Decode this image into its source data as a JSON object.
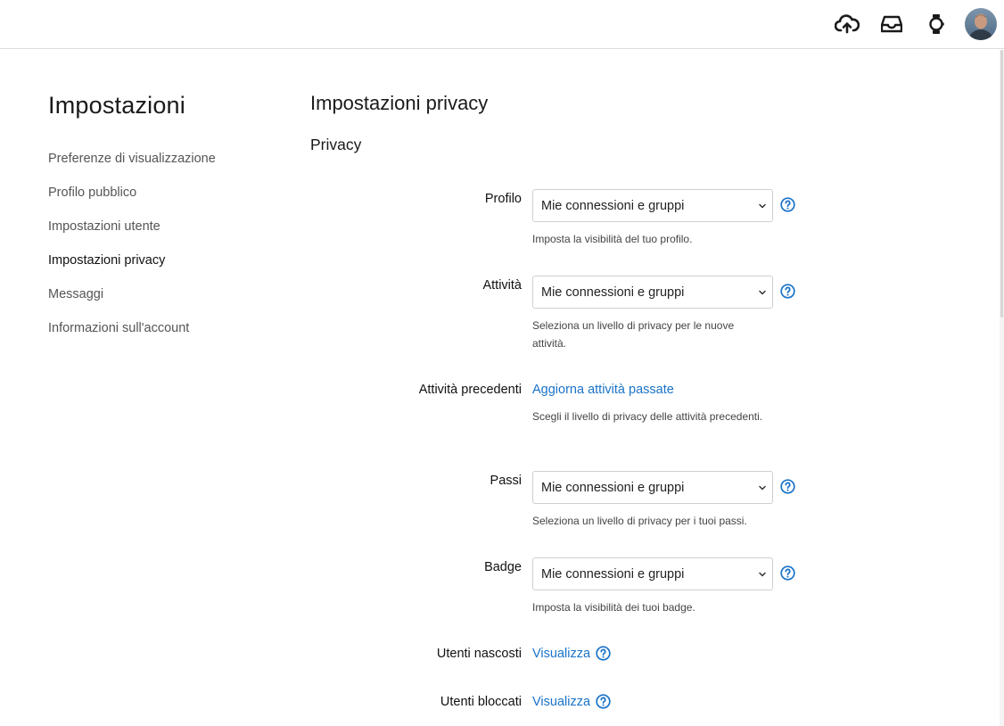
{
  "header": {
    "icons": {
      "upload": "cloud-upload-icon",
      "inbox": "inbox-icon",
      "device": "watch-icon",
      "avatar": "user-avatar"
    }
  },
  "sidebar": {
    "title": "Impostazioni",
    "items": [
      {
        "label": "Preferenze di visualizzazione",
        "active": false
      },
      {
        "label": "Profilo pubblico",
        "active": false
      },
      {
        "label": "Impostazioni utente",
        "active": false
      },
      {
        "label": "Impostazioni privacy",
        "active": true
      },
      {
        "label": "Messaggi",
        "active": false
      },
      {
        "label": "Informazioni sull'account",
        "active": false
      }
    ]
  },
  "main": {
    "page_title": "Impostazioni privacy",
    "section_title": "Privacy",
    "fields": {
      "profilo": {
        "label": "Profilo",
        "value": "Mie connessioni e gruppi",
        "hint": "Imposta la visibilità del tuo profilo."
      },
      "attivita": {
        "label": "Attività",
        "value": "Mie connessioni e gruppi",
        "hint": "Seleziona un livello di privacy per le nuove attività."
      },
      "attivita_precedenti": {
        "label": "Attività precedenti",
        "link": "Aggiorna attività passate",
        "hint": "Scegli il livello di privacy delle attività precedenti."
      },
      "passi": {
        "label": "Passi",
        "value": "Mie connessioni e gruppi",
        "hint": "Seleziona un livello di privacy per i tuoi passi."
      },
      "badge": {
        "label": "Badge",
        "value": "Mie connessioni e gruppi",
        "hint": "Imposta la visibilità dei tuoi badge."
      },
      "utenti_nascosti": {
        "label": "Utenti nascosti",
        "link": "Visualizza"
      },
      "utenti_bloccati": {
        "label": "Utenti bloccati",
        "link": "Visualizza"
      }
    }
  },
  "colors": {
    "accent": "#1a73c8",
    "text": "#1a1a1a",
    "muted": "#555555",
    "border": "#cfcfcf"
  }
}
